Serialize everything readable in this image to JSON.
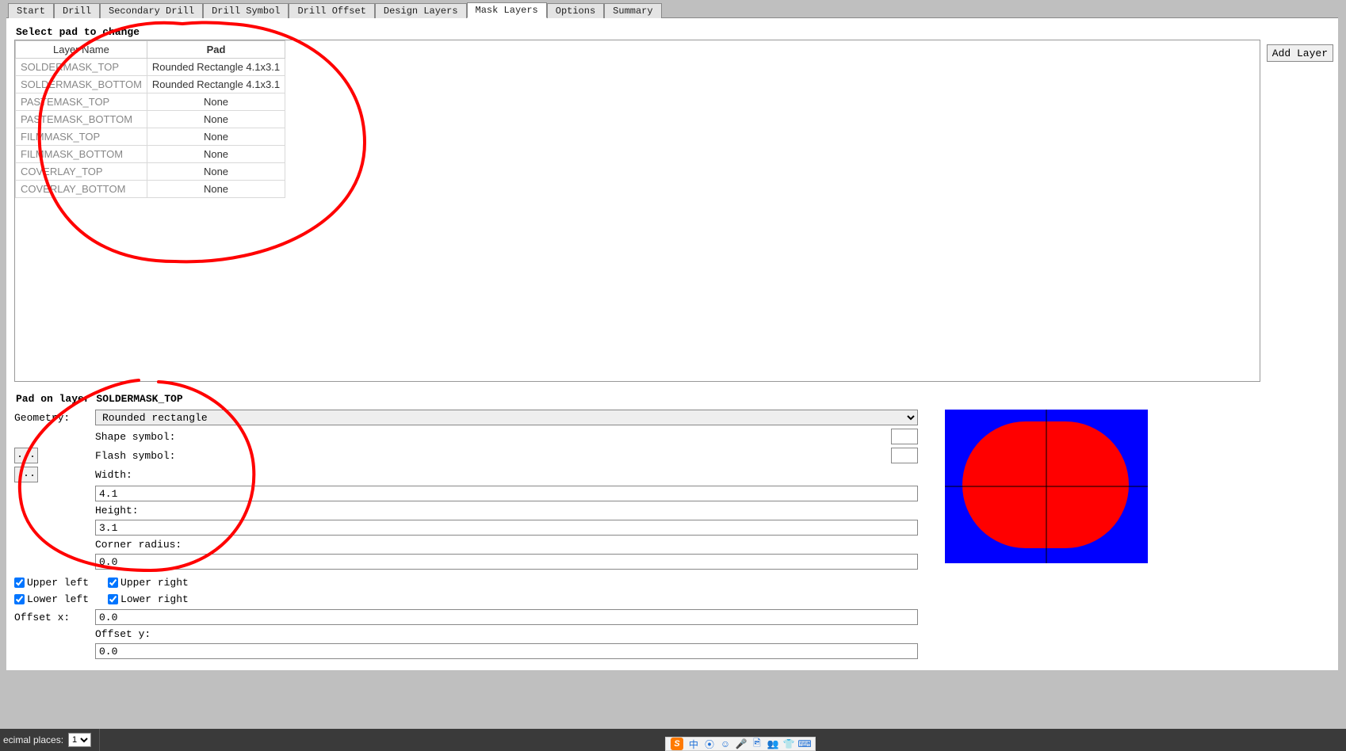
{
  "tabs": [
    {
      "label": "Start"
    },
    {
      "label": "Drill"
    },
    {
      "label": "Secondary Drill"
    },
    {
      "label": "Drill Symbol"
    },
    {
      "label": "Drill Offset"
    },
    {
      "label": "Design Layers"
    },
    {
      "label": "Mask Layers"
    },
    {
      "label": "Options"
    },
    {
      "label": "Summary"
    }
  ],
  "active_tab_index": 6,
  "section_select_label": "Select pad to change",
  "add_layer_label": "Add Layer",
  "table": {
    "headers": {
      "layer": "Layer Name",
      "pad": "Pad"
    },
    "rows": [
      {
        "layer": "SOLDERMASK_TOP",
        "pad": "Rounded Rectangle 4.1x3.1"
      },
      {
        "layer": "SOLDERMASK_BOTTOM",
        "pad": "Rounded Rectangle 4.1x3.1"
      },
      {
        "layer": "PASTEMASK_TOP",
        "pad": "None"
      },
      {
        "layer": "PASTEMASK_BOTTOM",
        "pad": "None"
      },
      {
        "layer": "FILMMASK_TOP",
        "pad": "None"
      },
      {
        "layer": "FILMMASK_BOTTOM",
        "pad": "None"
      },
      {
        "layer": "COVERLAY_TOP",
        "pad": "None"
      },
      {
        "layer": "COVERLAY_BOTTOM",
        "pad": "None"
      }
    ]
  },
  "form_title_prefix": "Pad on layer ",
  "form_title_layer": "SOLDERMASK_TOP",
  "form": {
    "geometry_label": "Geometry:",
    "geometry_value": "Rounded rectangle",
    "shape_symbol_label": "Shape symbol:",
    "shape_symbol_value": "",
    "flash_symbol_label": "Flash symbol:",
    "flash_symbol_value": "",
    "width_label": "Width:",
    "width_value": "4.1",
    "height_label": "Height:",
    "height_value": "3.1",
    "corner_radius_label": "Corner radius:",
    "corner_radius_value": "0.0",
    "upper_left_label": "Upper left",
    "upper_right_label": "Upper right",
    "lower_left_label": "Lower left",
    "lower_right_label": "Lower right",
    "offset_x_label": "Offset x:",
    "offset_x_value": "0.0",
    "offset_y_label": "Offset y:",
    "offset_y_value": "0.0",
    "ellipsis": "..."
  },
  "statusbar": {
    "decimal_label": "ecimal places:",
    "decimal_value": "1"
  },
  "tray": {
    "sogou": "S",
    "icons": [
      "中",
      "⦿",
      "☺",
      "🎤",
      "🖻",
      "👥",
      "👕",
      "⌨"
    ]
  }
}
